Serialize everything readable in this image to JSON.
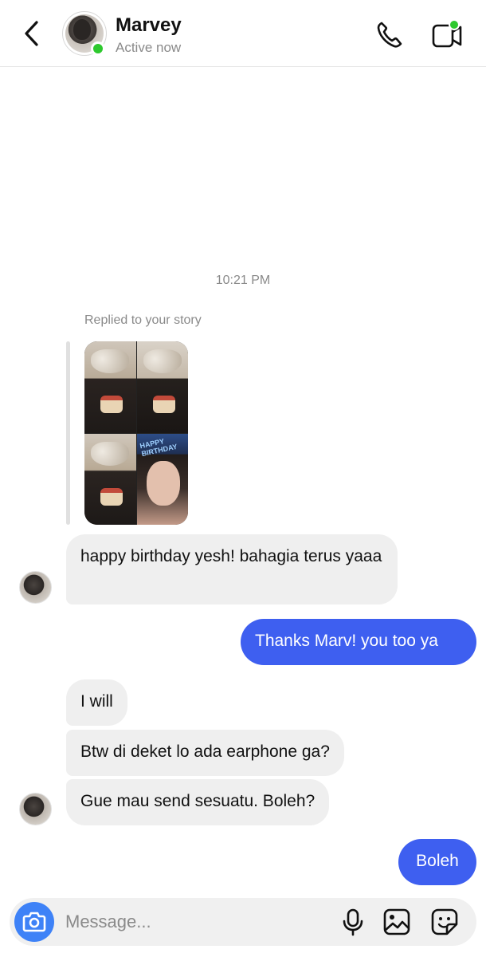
{
  "header": {
    "name": "Marvey",
    "status": "Active now",
    "online_color": "#2ec92e",
    "icons": {
      "back": "chevron-left-icon",
      "call": "phone-icon",
      "video": "video-camera-icon"
    }
  },
  "chat": {
    "timestamp": "10:21 PM",
    "story_reply_label": "Replied to your story",
    "story_thumbnail": {
      "overlay_text": "HAPPY BIRTHDAY"
    },
    "messages": [
      {
        "from": "them",
        "text": "happy birthday yesh! bahagia terus yaaa"
      },
      {
        "from": "me",
        "text": "Thanks Marv! you too ya"
      },
      {
        "from": "them",
        "text": "I will"
      },
      {
        "from": "them",
        "text": "Btw di deket lo ada earphone ga?"
      },
      {
        "from": "them",
        "text": "Gue mau send sesuatu. Boleh?"
      },
      {
        "from": "me",
        "text": "Boleh"
      }
    ],
    "colors": {
      "incoming_bubble": "#efefef",
      "outgoing_bubble": "#3e5ff0"
    }
  },
  "composer": {
    "placeholder": "Message...",
    "icons": {
      "camera": "camera-icon",
      "mic": "microphone-icon",
      "gallery": "image-icon",
      "sticker": "sticker-icon"
    },
    "camera_color": "#3e82f7"
  }
}
